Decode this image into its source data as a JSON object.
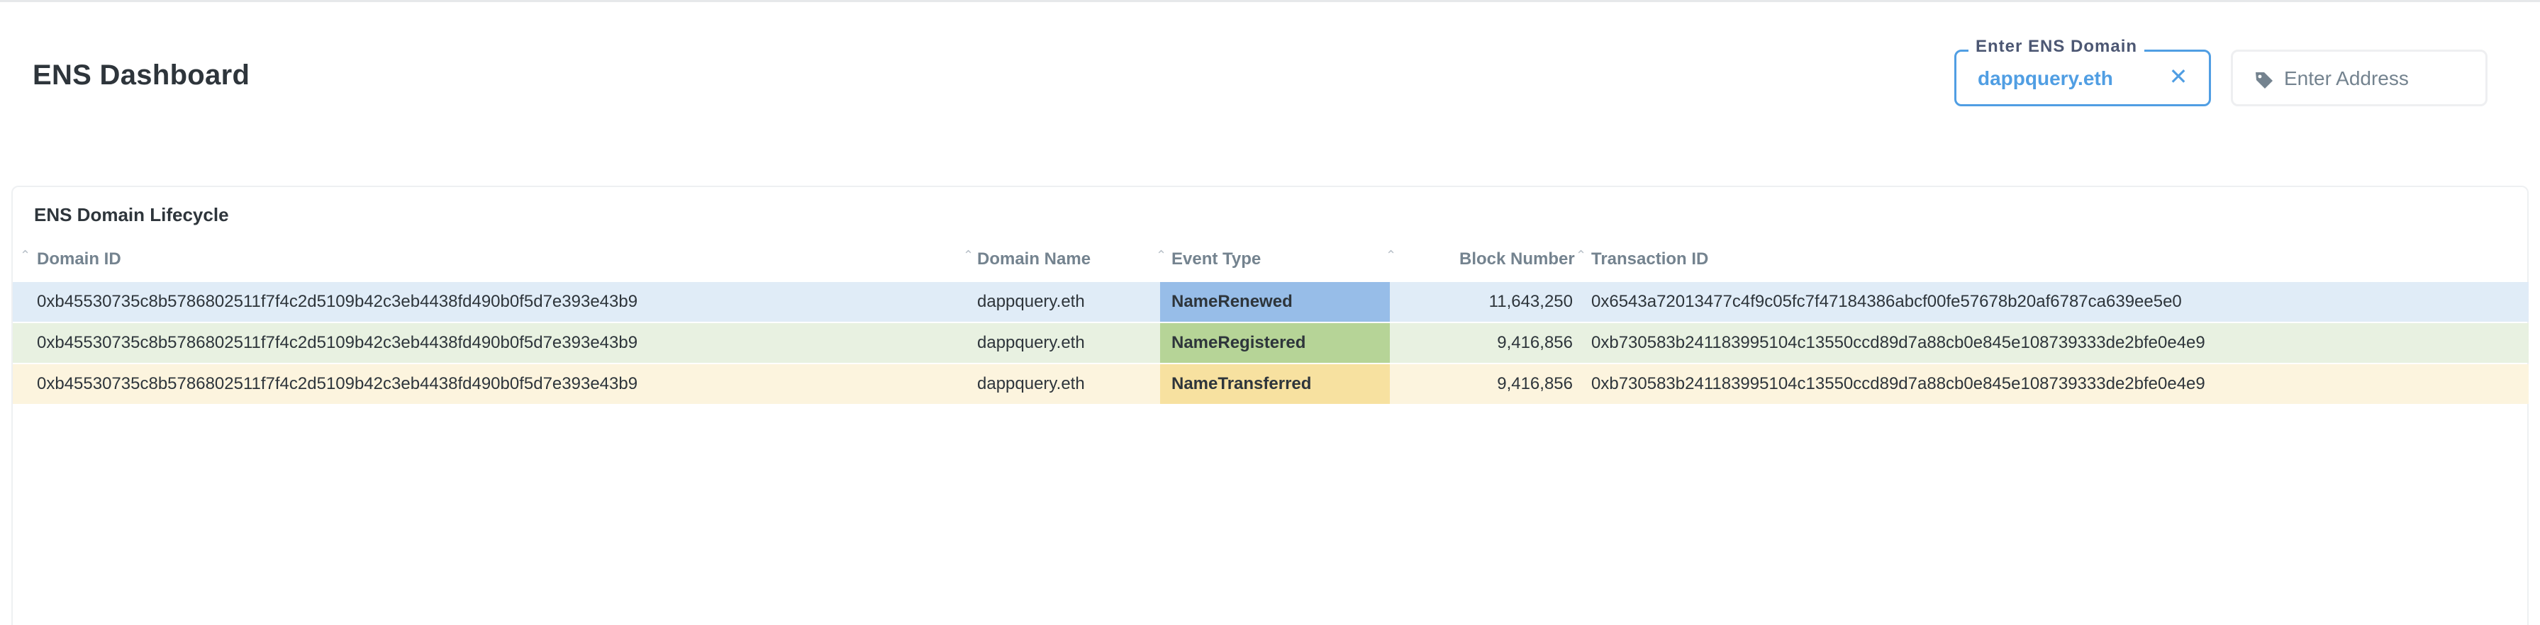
{
  "header": {
    "title": "ENS Dashboard",
    "domain_filter": {
      "label": "Enter ENS Domain",
      "value": "dappquery.eth"
    },
    "address_filter": {
      "placeholder": "Enter Address"
    }
  },
  "card": {
    "title": "ENS Domain Lifecycle",
    "columns": [
      "Domain ID",
      "Domain Name",
      "Event Type",
      "Block Number",
      "Transaction ID"
    ],
    "rows": [
      {
        "domain_id": "0xb45530735c8b5786802511f7f4c2d5109b42c3eb4438fd490b0f5d7e393e43b9",
        "domain_name": "dappquery.eth",
        "event_type": "NameRenewed",
        "block_number": "11,643,250",
        "transaction_id": "0x6543a72013477c4f9c05fc7f47184386abcf00fe57678b20af6787ca639ee5e0",
        "row_color": "#e0ecf7",
        "event_color": "#97bde8"
      },
      {
        "domain_id": "0xb45530735c8b5786802511f7f4c2d5109b42c3eb4438fd490b0f5d7e393e43b9",
        "domain_name": "dappquery.eth",
        "event_type": "NameRegistered",
        "block_number": "9,416,856",
        "transaction_id": "0xb730583b241183995104c13550ccd89d7a88cb0e845e108739333de2bfe0e4e9",
        "row_color": "#e8f1e1",
        "event_color": "#b6d497"
      },
      {
        "domain_id": "0xb45530735c8b5786802511f7f4c2d5109b42c3eb4438fd490b0f5d7e393e43b9",
        "domain_name": "dappquery.eth",
        "event_type": "NameTransferred",
        "block_number": "9,416,856",
        "transaction_id": "0xb730583b241183995104c13550ccd89d7a88cb0e845e108739333de2bfe0e4e9",
        "row_color": "#fcf4de",
        "event_color": "#f7e1a0"
      }
    ]
  },
  "colors": {
    "accent": "#509ee3",
    "text": "#2e353b",
    "muted": "#74838f"
  },
  "icons": {
    "clear": "close-icon",
    "address": "tag-icon",
    "sort": "chevron-up-icon"
  }
}
